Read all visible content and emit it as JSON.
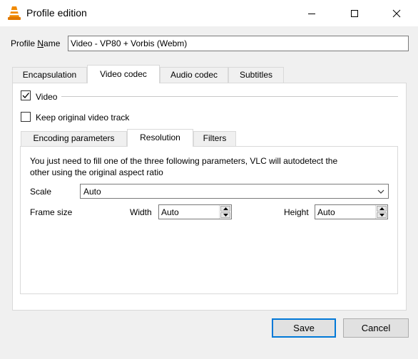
{
  "window": {
    "title": "Profile edition",
    "icon": "vlc-cone-icon",
    "controls": [
      "minimize-icon",
      "maximize-icon",
      "close-icon"
    ]
  },
  "profile": {
    "name_label_prefix": "Profile ",
    "name_label_mnemonic": "N",
    "name_label_suffix": "ame",
    "name_value": "Video - VP80 + Vorbis (Webm)"
  },
  "tabs": [
    {
      "label": "Encapsulation",
      "active": false
    },
    {
      "label": "Video codec",
      "active": true
    },
    {
      "label": "Audio codec",
      "active": false
    },
    {
      "label": "Subtitles",
      "active": false
    }
  ],
  "video": {
    "enable_label": "Video",
    "enable_checked": true,
    "keep_original_label": "Keep original video track",
    "keep_original_checked": false
  },
  "subtabs": [
    {
      "label": "Encoding parameters",
      "active": false
    },
    {
      "label": "Resolution",
      "active": true
    },
    {
      "label": "Filters",
      "active": false
    }
  ],
  "resolution": {
    "info_line1": "You just need to fill one of the three following parameters, VLC will autodetect the",
    "info_line2": "other using the original aspect ratio",
    "scale_label": "Scale",
    "scale_value": "Auto",
    "frame_size_label": "Frame size",
    "width_label": "Width",
    "width_value": "Auto",
    "height_label": "Height",
    "height_value": "Auto"
  },
  "buttons": {
    "save": "Save",
    "cancel": "Cancel"
  },
  "colors": {
    "accent": "#0078d7",
    "vlc_orange": "#f18a00"
  }
}
